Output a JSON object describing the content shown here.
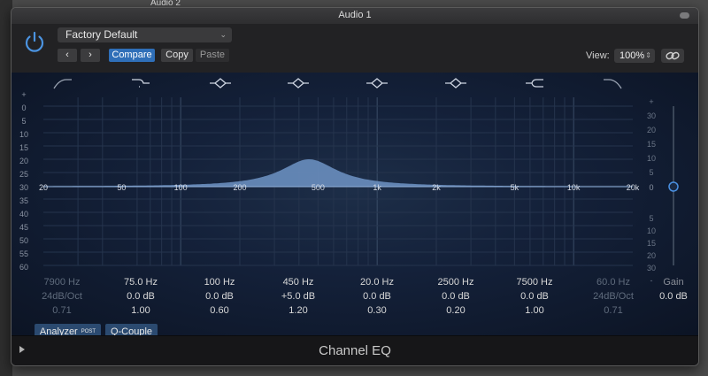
{
  "background": {
    "track_name": "Audio 2"
  },
  "window": {
    "title": "Audio 1",
    "plugin_name": "Channel EQ"
  },
  "toolbar": {
    "preset": "Factory Default",
    "prev_label": "‹",
    "next_label": "›",
    "compare_label": "Compare",
    "copy_label": "Copy",
    "paste_label": "Paste",
    "view_label": "View:",
    "zoom_value": "100%"
  },
  "graph": {
    "left_scale": [
      "+",
      "0",
      "5",
      "10",
      "15",
      "20",
      "25",
      "30",
      "35",
      "40",
      "45",
      "50",
      "55",
      "60"
    ],
    "right_scale_top": [
      "+",
      "30",
      "20",
      "15",
      "10",
      "5"
    ],
    "right_zero": "0",
    "right_scale_bottom": [
      "5",
      "10",
      "15",
      "20",
      "30",
      "-"
    ],
    "freq_labels": [
      "20",
      "50",
      "100",
      "200",
      "500",
      "1k",
      "2k",
      "5k",
      "10k",
      "20k"
    ],
    "freq_values": [
      20,
      50,
      100,
      200,
      500,
      1000,
      2000,
      5000,
      10000,
      20000
    ]
  },
  "bands": [
    {
      "freq": "7900 Hz",
      "gain": "24dB/Oct",
      "q": "0.71",
      "enabled": false,
      "icon": "low-cut-icon"
    },
    {
      "freq": "75.0 Hz",
      "gain": "0.0 dB",
      "q": "1.00",
      "enabled": true,
      "icon": "low-shelf-icon"
    },
    {
      "freq": "100 Hz",
      "gain": "0.0 dB",
      "q": "0.60",
      "enabled": true,
      "icon": "bell-icon"
    },
    {
      "freq": "450 Hz",
      "gain": "+5.0 dB",
      "q": "1.20",
      "enabled": true,
      "icon": "bell-icon"
    },
    {
      "freq": "20.0 Hz",
      "gain": "0.0 dB",
      "q": "0.30",
      "enabled": true,
      "icon": "bell-icon"
    },
    {
      "freq": "2500 Hz",
      "gain": "0.0 dB",
      "q": "0.20",
      "enabled": true,
      "icon": "bell-icon"
    },
    {
      "freq": "7500 Hz",
      "gain": "0.0 dB",
      "q": "1.00",
      "enabled": true,
      "icon": "high-shelf-icon"
    },
    {
      "freq": "60.0 Hz",
      "gain": "24dB/Oct",
      "q": "0.71",
      "enabled": false,
      "icon": "high-cut-icon"
    }
  ],
  "gain": {
    "label": "Gain",
    "value": "0.0 dB"
  },
  "options": {
    "analyzer_label": "Analyzer",
    "analyzer_tag": "POST",
    "qcouple_label": "Q-Couple"
  },
  "colors": {
    "accent": "#2f6fb8",
    "curve_fill": "#6f94c6",
    "gain_knob": "#4a90e2"
  }
}
